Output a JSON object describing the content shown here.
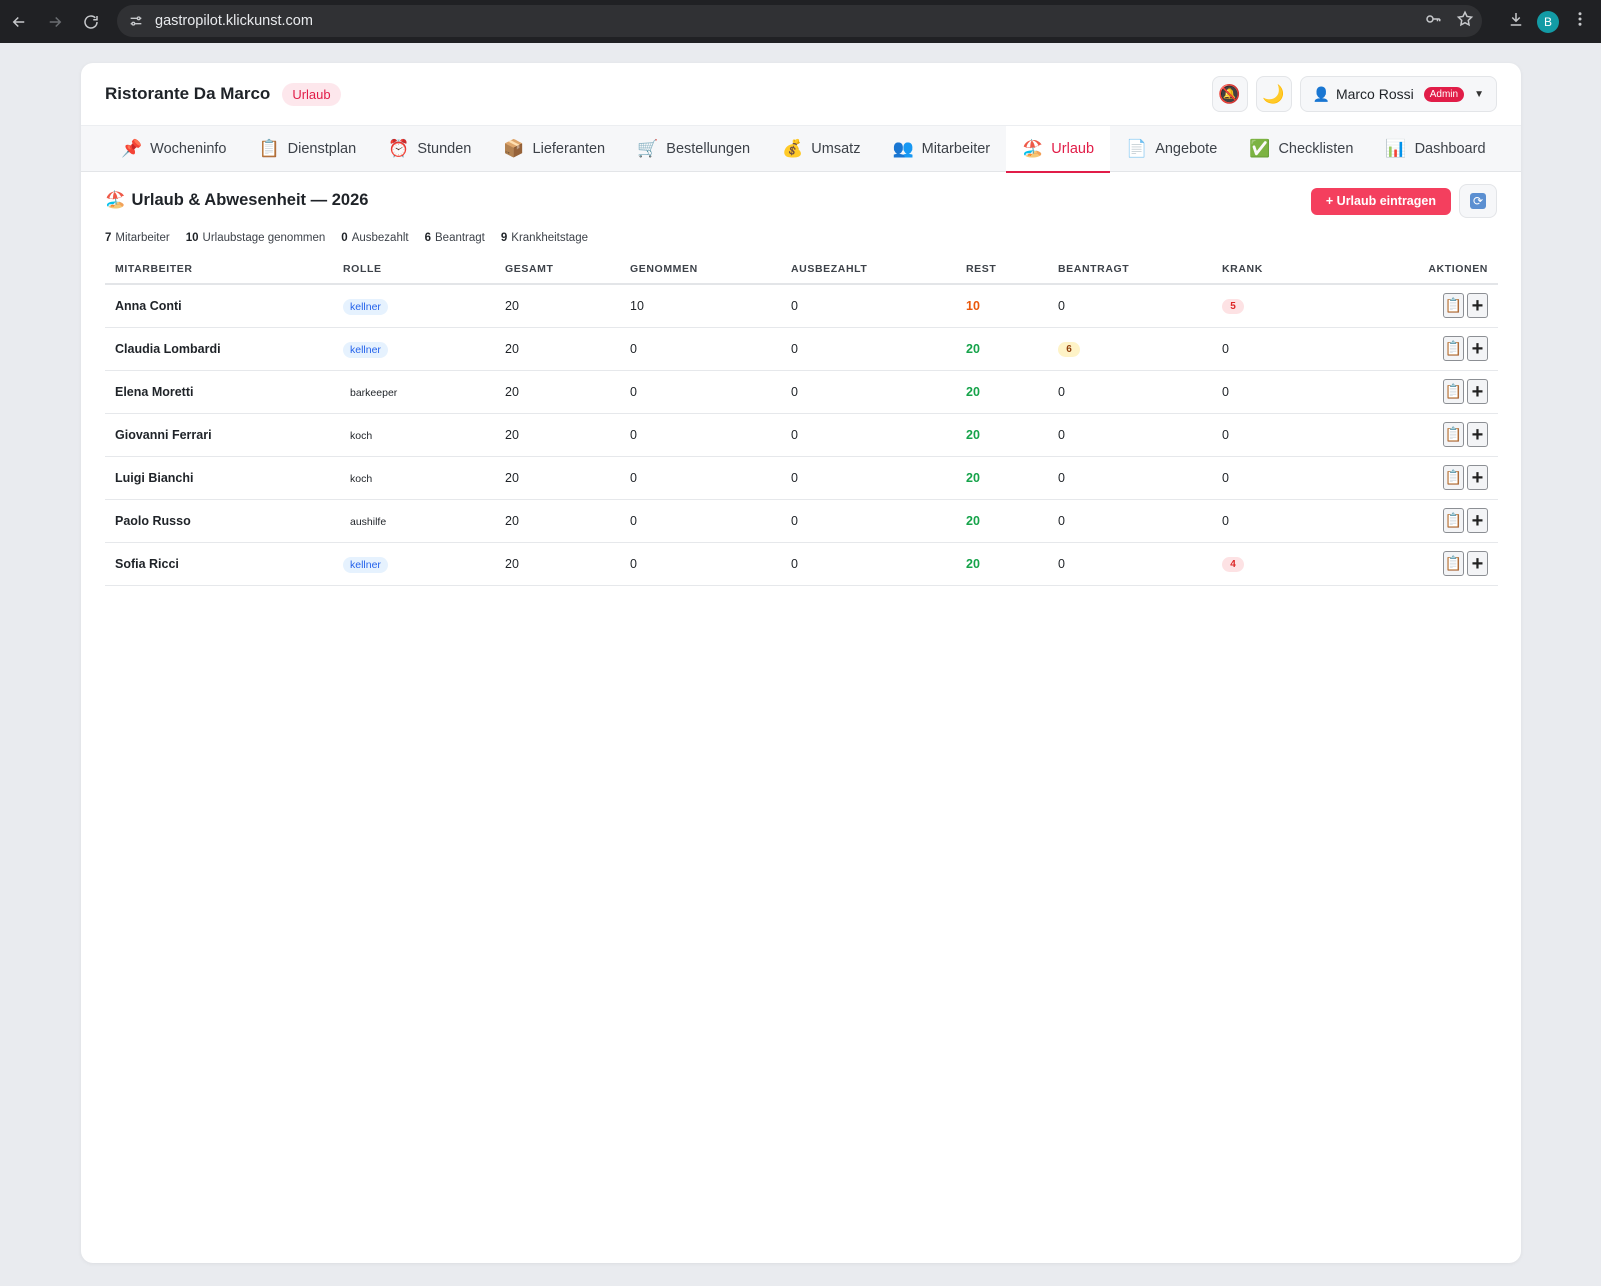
{
  "browser": {
    "url": "gastropilot.klickunst.com",
    "profile_initial": "B"
  },
  "header": {
    "brand": "Ristorante Da Marco",
    "section_badge": "Urlaub",
    "user_name": "Marco Rossi",
    "user_role": "Admin"
  },
  "tabs": [
    {
      "icon": "📌",
      "label": "Wocheninfo"
    },
    {
      "icon": "📋",
      "label": "Dienstplan"
    },
    {
      "icon": "⏰",
      "label": "Stunden"
    },
    {
      "icon": "📦",
      "label": "Lieferanten"
    },
    {
      "icon": "🛒",
      "label": "Bestellungen"
    },
    {
      "icon": "💰",
      "label": "Umsatz"
    },
    {
      "icon": "👥",
      "label": "Mitarbeiter"
    },
    {
      "icon": "🏖️",
      "label": "Urlaub"
    },
    {
      "icon": "📄",
      "label": "Angebote"
    },
    {
      "icon": "✅",
      "label": "Checklisten"
    },
    {
      "icon": "📊",
      "label": "Dashboard"
    }
  ],
  "page": {
    "icon": "🏖️",
    "title": "Urlaub & Abwesenheit — 2026",
    "add_button": "+ Urlaub eintragen"
  },
  "stats": [
    {
      "value": "7",
      "label": "Mitarbeiter"
    },
    {
      "value": "10",
      "label": "Urlaubstage genommen"
    },
    {
      "value": "0",
      "label": "Ausbezahlt"
    },
    {
      "value": "6",
      "label": "Beantragt"
    },
    {
      "value": "9",
      "label": "Krankheitstage"
    }
  ],
  "table": {
    "columns": [
      "MITARBEITER",
      "ROLLE",
      "GESAMT",
      "GENOMMEN",
      "AUSBEZAHLT",
      "REST",
      "BEANTRAGT",
      "KRANK",
      "AKTIONEN"
    ],
    "rows": [
      {
        "name": "Anna Conti",
        "role": "kellner",
        "gesamt": "20",
        "genommen": "10",
        "ausbezahlt": "0",
        "rest": "10",
        "beantragt": "0",
        "krank": "5"
      },
      {
        "name": "Claudia Lombardi",
        "role": "kellner",
        "gesamt": "20",
        "genommen": "0",
        "ausbezahlt": "0",
        "rest": "20",
        "beantragt": "6",
        "krank": "0"
      },
      {
        "name": "Elena Moretti",
        "role": "barkeeper",
        "gesamt": "20",
        "genommen": "0",
        "ausbezahlt": "0",
        "rest": "20",
        "beantragt": "0",
        "krank": "0"
      },
      {
        "name": "Giovanni Ferrari",
        "role": "koch",
        "gesamt": "20",
        "genommen": "0",
        "ausbezahlt": "0",
        "rest": "20",
        "beantragt": "0",
        "krank": "0"
      },
      {
        "name": "Luigi Bianchi",
        "role": "koch",
        "gesamt": "20",
        "genommen": "0",
        "ausbezahlt": "0",
        "rest": "20",
        "beantragt": "0",
        "krank": "0"
      },
      {
        "name": "Paolo Russo",
        "role": "aushilfe",
        "gesamt": "20",
        "genommen": "0",
        "ausbezahlt": "0",
        "rest": "20",
        "beantragt": "0",
        "krank": "0"
      },
      {
        "name": "Sofia Ricci",
        "role": "kellner",
        "gesamt": "20",
        "genommen": "0",
        "ausbezahlt": "0",
        "rest": "20",
        "beantragt": "0",
        "krank": "4"
      }
    ]
  },
  "colors": {
    "accent": "#e11d48",
    "rest_warning": "#ea580c",
    "rest_ok": "#16a34a"
  }
}
